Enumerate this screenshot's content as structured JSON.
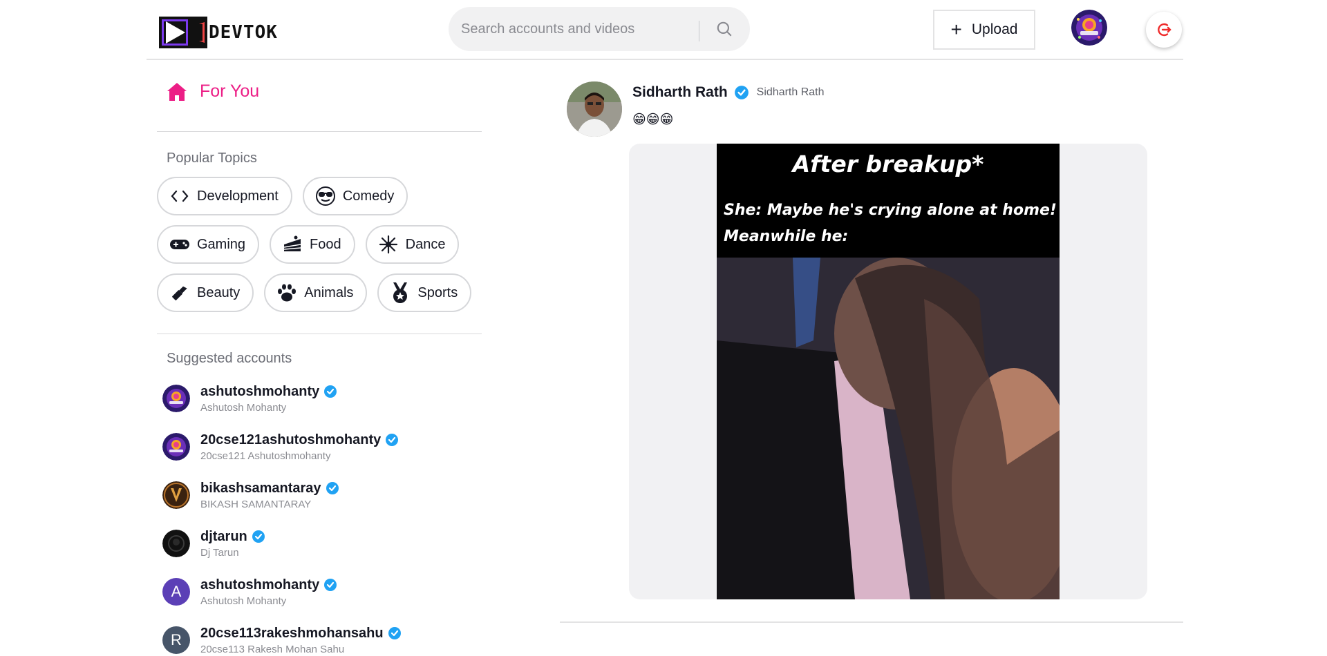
{
  "header": {
    "logo_text": "DEVTOK",
    "search_placeholder": "Search accounts and videos",
    "upload_label": "Upload"
  },
  "sidebar": {
    "for_you": "For You",
    "popular_topics_title": "Popular Topics",
    "topics": [
      {
        "label": "Development",
        "icon": "code-icon"
      },
      {
        "label": "Comedy",
        "icon": "sunglasses-face-icon"
      },
      {
        "label": "Gaming",
        "icon": "gamepad-icon"
      },
      {
        "label": "Food",
        "icon": "cake-icon"
      },
      {
        "label": "Dance",
        "icon": "dance-icon"
      },
      {
        "label": "Beauty",
        "icon": "lipstick-icon"
      },
      {
        "label": "Animals",
        "icon": "paw-icon"
      },
      {
        "label": "Sports",
        "icon": "medal-icon"
      }
    ],
    "suggested_title": "Suggested accounts",
    "accounts": [
      {
        "username": "ashutoshmohanty",
        "name": "Ashutosh Mohanty",
        "avatar": "logo-avatar"
      },
      {
        "username": "20cse121ashutoshmohanty",
        "name": "20cse121 Ashutoshmohanty",
        "avatar": "logo-avatar"
      },
      {
        "username": "bikashsamantaray",
        "name": "BIKASH SAMANTARAY",
        "avatar": "photo-avatar"
      },
      {
        "username": "djtarun",
        "name": "Dj Tarun",
        "avatar": "dark-avatar"
      },
      {
        "username": "ashutoshmohanty",
        "name": "Ashutosh Mohanty",
        "avatar": "A",
        "avatar_color": "#5b3fb6"
      },
      {
        "username": "20cse113rakeshmohansahu",
        "name": "20cse113 Rakesh Mohan Sahu",
        "avatar": "R",
        "avatar_color": "#475569"
      }
    ]
  },
  "post": {
    "username": "Sidharth Rath",
    "display_name": "Sidharth Rath",
    "caption": "😁😁😁",
    "video_text": {
      "title": "After breakup*",
      "line1": "She: Maybe he's crying alone at home!",
      "line2": "Meanwhile he:"
    }
  },
  "colors": {
    "accent_pink": "#ec1e86",
    "verified_blue": "#20a2f3",
    "logout_red": "#ef2b2b"
  }
}
